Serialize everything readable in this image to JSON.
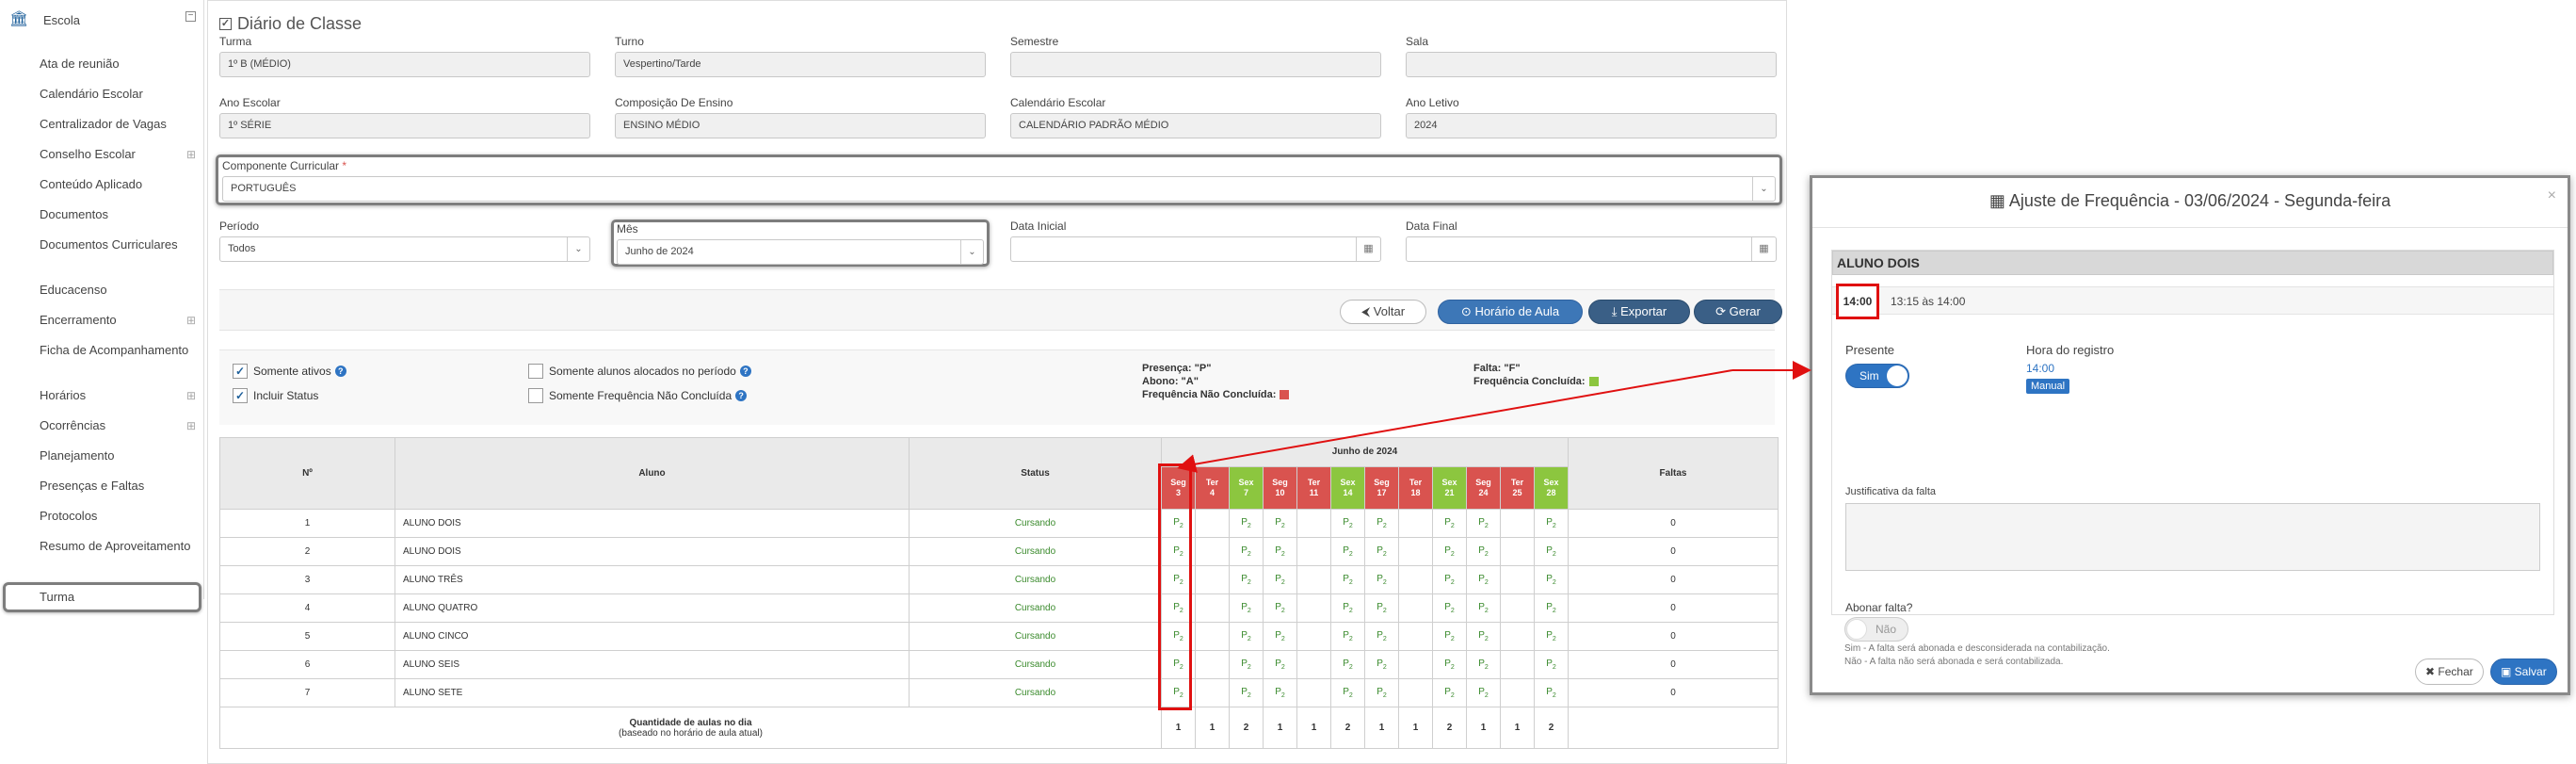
{
  "sidebar": {
    "header": "Escola",
    "items": [
      {
        "label": "Ata de reunião",
        "expandable": false
      },
      {
        "label": "Calendário Escolar",
        "expandable": false
      },
      {
        "label": "Centralizador de Vagas",
        "expandable": false
      },
      {
        "label": "Conselho Escolar",
        "expandable": true
      },
      {
        "label": "Conteúdo Aplicado",
        "expandable": false
      },
      {
        "label": "Documentos",
        "expandable": false
      },
      {
        "label": "Documentos Curriculares",
        "expandable": false
      },
      {
        "label": "Educacenso",
        "expandable": false
      },
      {
        "label": "Encerramento",
        "expandable": true
      },
      {
        "label": "Ficha de Acompanhamento",
        "expandable": false
      },
      {
        "label": "Horários",
        "expandable": true
      },
      {
        "label": "Ocorrências",
        "expandable": true
      },
      {
        "label": "Planejamento",
        "expandable": false
      },
      {
        "label": "Presenças e Faltas",
        "expandable": false
      },
      {
        "label": "Protocolos",
        "expandable": false
      },
      {
        "label": "Resumo de Aproveitamento",
        "expandable": false
      }
    ],
    "active_item": "Turma"
  },
  "page": {
    "title": "Diário de Classe"
  },
  "form": {
    "turma": {
      "label": "Turma",
      "value": "1º B (MÉDIO)"
    },
    "turno": {
      "label": "Turno",
      "value": "Vespertino/Tarde"
    },
    "semestre": {
      "label": "Semestre",
      "value": ""
    },
    "sala": {
      "label": "Sala",
      "value": ""
    },
    "ano_escolar": {
      "label": "Ano Escolar",
      "value": "1º SÉRIE"
    },
    "composicao": {
      "label": "Composição De Ensino",
      "value": "ENSINO MÉDIO"
    },
    "calendario": {
      "label": "Calendário Escolar",
      "value": "CALENDÁRIO PADRÃO MÉDIO"
    },
    "ano_letivo": {
      "label": "Ano Letivo",
      "value": "2024"
    },
    "componente": {
      "label": "Componente Curricular",
      "required": "*",
      "value": "PORTUGUÊS"
    },
    "periodo": {
      "label": "Período",
      "value": "Todos"
    },
    "mes": {
      "label": "Mês",
      "value": "Junho de 2024"
    },
    "data_inicial": {
      "label": "Data Inicial",
      "value": ""
    },
    "data_final": {
      "label": "Data Final",
      "value": ""
    }
  },
  "buttons": {
    "voltar": "Voltar",
    "horario": "Horário de Aula",
    "exportar": "Exportar",
    "gerar": "Gerar"
  },
  "filters": {
    "somente_ativos": {
      "label": "Somente ativos",
      "checked": true
    },
    "incluir_status": {
      "label": "Incluir Status",
      "checked": true
    },
    "alocados": {
      "label": "Somente alunos alocados no período",
      "checked": false
    },
    "nao_concluida": {
      "label": "Somente Frequência Não Concluída",
      "checked": false
    }
  },
  "legend": {
    "presenca": "Presença: \"P\"",
    "abono": "Abono: \"A\"",
    "nao_concluida": "Frequência Não Concluída:",
    "falta": "Falta: \"F\"",
    "concluida": "Frequência Concluída:",
    "color_red": "#d9534f",
    "color_green": "#8cc63f"
  },
  "table": {
    "col_num": "Nº",
    "col_aluno": "Aluno",
    "col_status": "Status",
    "month": "Junho de 2024",
    "col_faltas": "Faltas",
    "days": [
      {
        "dow": "Seg",
        "day": "3",
        "status": "red"
      },
      {
        "dow": "Ter",
        "day": "4",
        "status": "red"
      },
      {
        "dow": "Sex",
        "day": "7",
        "status": "green"
      },
      {
        "dow": "Seg",
        "day": "10",
        "status": "red"
      },
      {
        "dow": "Ter",
        "day": "11",
        "status": "red"
      },
      {
        "dow": "Sex",
        "day": "14",
        "status": "green"
      },
      {
        "dow": "Seg",
        "day": "17",
        "status": "red"
      },
      {
        "dow": "Ter",
        "day": "18",
        "status": "red"
      },
      {
        "dow": "Sex",
        "day": "21",
        "status": "green"
      },
      {
        "dow": "Seg",
        "day": "24",
        "status": "red"
      },
      {
        "dow": "Ter",
        "day": "25",
        "status": "red"
      },
      {
        "dow": "Sex",
        "day": "28",
        "status": "green"
      }
    ],
    "rows": [
      {
        "n": "1",
        "aluno": "ALUNO DOIS",
        "status": "Cursando",
        "faltas": "0"
      },
      {
        "n": "2",
        "aluno": "ALUNO DOIS",
        "status": "Cursando",
        "faltas": "0"
      },
      {
        "n": "3",
        "aluno": "ALUNO TRÊS",
        "status": "Cursando",
        "faltas": "0"
      },
      {
        "n": "4",
        "aluno": "ALUNO QUATRO",
        "status": "Cursando",
        "faltas": "0"
      },
      {
        "n": "5",
        "aluno": "ALUNO CINCO",
        "status": "Cursando",
        "faltas": "0"
      },
      {
        "n": "6",
        "aluno": "ALUNO SEIS",
        "status": "Cursando",
        "faltas": "0"
      },
      {
        "n": "7",
        "aluno": "ALUNO SETE",
        "status": "Cursando",
        "faltas": "0"
      }
    ],
    "presence_pattern": [
      "P2",
      "",
      "P2",
      "P2",
      "",
      "P2",
      "P2",
      "",
      "P2",
      "P2",
      "",
      "P2"
    ],
    "qty_label": "Quantidade de aulas no dia",
    "qty_sub": "(baseado no horário de aula atual)",
    "qty_values": [
      "1",
      "1",
      "2",
      "1",
      "1",
      "2",
      "1",
      "1",
      "2",
      "1",
      "1",
      "2"
    ]
  },
  "modal": {
    "title": "Ajuste de Frequência - 03/06/2024 - Segunda-feira",
    "close": "×",
    "student": "ALUNO DOIS",
    "slot": "14:00",
    "slot_range": "13:15 às 14:00",
    "presente_label": "Presente",
    "presente_value": "Sim",
    "hora_label": "Hora do registro",
    "hora_value": "14:00",
    "hora_badge": "Manual",
    "justificativa_label": "Justificativa da falta",
    "abonar_label": "Abonar falta?",
    "abonar_value": "Não",
    "note_sim": "Sim - A falta será abonada e desconsiderada na contabilização.",
    "note_nao": "Não - A falta não será abonada e será contabilizada.",
    "btn_fechar": "Fechar",
    "btn_salvar": "Salvar"
  }
}
